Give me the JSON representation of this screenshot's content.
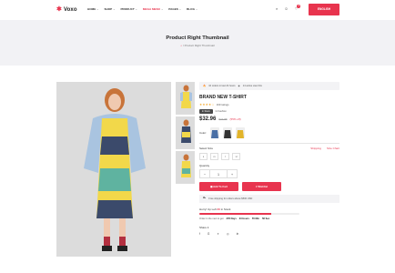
{
  "header": {
    "logo": "Voxo",
    "nav": [
      {
        "label": "HOME",
        "hot": false
      },
      {
        "label": "SHOP",
        "hot": false
      },
      {
        "label": "PRODUCT",
        "hot": false
      },
      {
        "label": "MEGA MENU",
        "hot": true
      },
      {
        "label": "PAGES",
        "hot": false
      },
      {
        "label": "BLOG",
        "hot": false
      }
    ],
    "cart_count": "0",
    "language_button": "ENGLISH"
  },
  "banner": {
    "title": "Product Right Thumbnail",
    "breadcrumb": "Product Right Thumbnail"
  },
  "product": {
    "promo": "10 orders in last 24 hours",
    "viewers": "14 active view this",
    "name": "BRAND NEW T-SHIRT",
    "rating": 4,
    "reviews": "169 ratings",
    "stock_badge": "In Stock",
    "stock_text": "In Fashion",
    "price": "$32.96",
    "old_price": "$41.88",
    "sale": "(55% off)",
    "color_label": "Color:",
    "size_label": "Select Size",
    "shipping_link": "Shipping",
    "size_chart_link": "Size Chart",
    "sizes": [
      "s",
      "m",
      "l",
      "xl"
    ],
    "quantity_label": "Quantity",
    "quantity": "1",
    "add_to_cart": "Add To Cart",
    "wishlist": "Wishlist",
    "shipping_note": "Free shipping for orders above $500 USD",
    "hurry_text": "Hurry! Up Left",
    "hurry_count": "20",
    "hurry_suffix": "in Stock",
    "stock_fraction": 0.72,
    "order_text": "Order in the next to get",
    "countdown": [
      "378 Days",
      "23 Hours",
      "55 Min",
      "58 Sec"
    ],
    "share_label": "Share it",
    "social": [
      "f",
      "g",
      "tw",
      "ig",
      "in"
    ]
  },
  "colors": {
    "accent": "#e8344e"
  },
  "icons": [
    "star-icon",
    "search-icon",
    "user-icon",
    "cart-icon",
    "fire-icon",
    "home-icon",
    "truck-icon",
    "bag-icon",
    "heart-icon"
  ]
}
